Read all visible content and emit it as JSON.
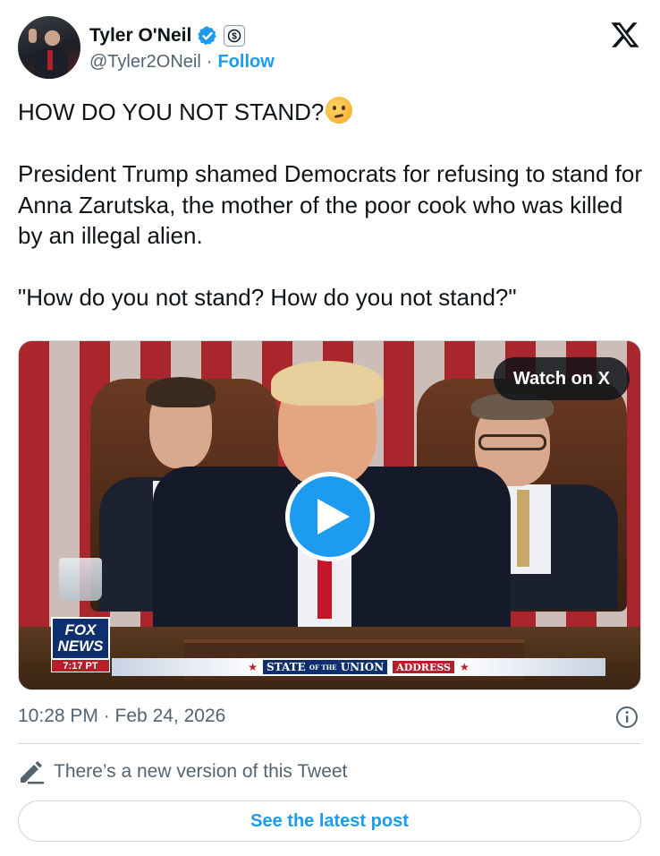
{
  "author": {
    "display_name": "Tyler O'Neil",
    "handle": "@Tyler2ONeil",
    "separator": "·",
    "follow_label": "Follow"
  },
  "tweet": {
    "line1": "HOW DO YOU NOT STAND?",
    "paragraph2": "President Trump shamed Democrats for refusing to stand for Anna Zarutska, the mother of the poor cook who was killed by an illegal alien.",
    "paragraph3": "\"How do you not stand? How do you not stand?\""
  },
  "media": {
    "watch_label": "Watch on X",
    "fox_line1": "FOX",
    "fox_line2": "NEWS",
    "fox_time": "7:17 PT",
    "banner_state": "STATE",
    "banner_of": "OF THE",
    "banner_union": "UNION",
    "banner_address": "ADDRESS"
  },
  "meta": {
    "timestamp": "10:28 PM · Feb 24, 2026"
  },
  "footer": {
    "new_version_text": "There’s a new version of this Tweet",
    "see_latest_label": "See the latest post"
  },
  "colors": {
    "accent": "#1d9bf0",
    "text": "#0f1419",
    "muted": "#536471",
    "border": "#cfd9de"
  },
  "icons": [
    "verified-badge-icon",
    "subscription-badge-icon",
    "x-logo-icon",
    "thinking-face-emoji",
    "play-icon",
    "info-icon",
    "pencil-icon"
  ]
}
